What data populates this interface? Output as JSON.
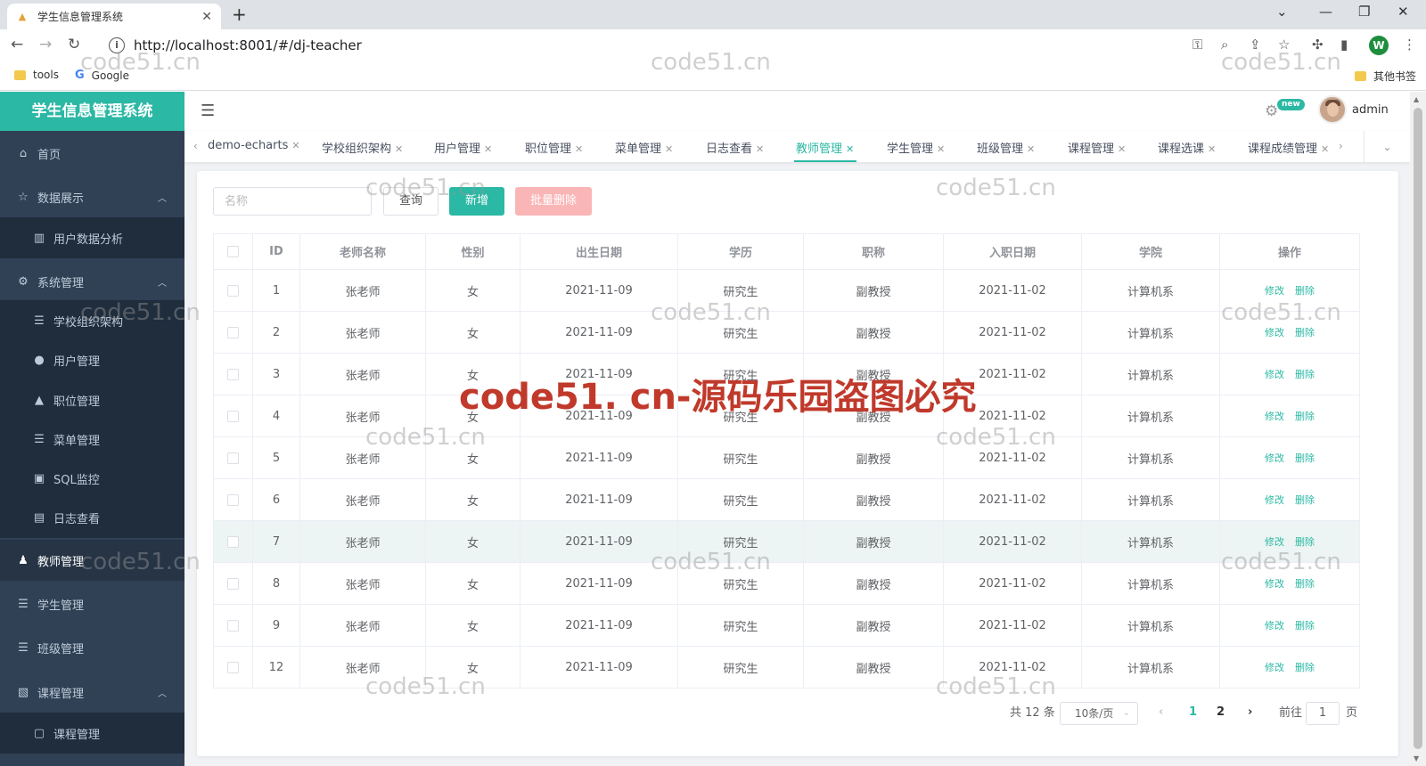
{
  "browser": {
    "tab_title": "学生信息管理系统",
    "tab_close": "✕",
    "new_tab": "+",
    "url": "http://localhost:8001/#/dj-teacher",
    "profile_initial": "W",
    "bookmarks": [
      "tools",
      "Google"
    ],
    "other_bookmarks": "其他书签"
  },
  "app": {
    "brand": "学生信息管理系统",
    "user": "admin",
    "new_badge": "new",
    "accent_color": "#2bb8a4"
  },
  "sidebar": {
    "items": [
      {
        "label": "首页",
        "icon": "home-icon",
        "level": "top"
      },
      {
        "label": "数据展示",
        "icon": "star-icon",
        "level": "top",
        "expanded": true
      },
      {
        "label": "用户数据分析",
        "icon": "bar-chart-icon",
        "level": "sub"
      },
      {
        "label": "系统管理",
        "icon": "gear-icon",
        "level": "top",
        "expanded": true
      },
      {
        "label": "学校组织架构",
        "icon": "list-icon",
        "level": "sub"
      },
      {
        "label": "用户管理",
        "icon": "user-icon",
        "level": "sub"
      },
      {
        "label": "职位管理",
        "icon": "lock-icon",
        "level": "sub"
      },
      {
        "label": "菜单管理",
        "icon": "list-icon",
        "level": "sub"
      },
      {
        "label": "SQL监控",
        "icon": "monitor-icon",
        "level": "sub"
      },
      {
        "label": "日志查看",
        "icon": "document-icon",
        "level": "sub"
      },
      {
        "label": "教师管理",
        "icon": "teacher-icon",
        "level": "top",
        "active": true
      },
      {
        "label": "学生管理",
        "icon": "list-icon",
        "level": "top"
      },
      {
        "label": "班级管理",
        "icon": "list-icon",
        "level": "top"
      },
      {
        "label": "课程管理",
        "icon": "book-icon",
        "level": "top",
        "expanded": true
      },
      {
        "label": "课程管理",
        "icon": "chat-icon",
        "level": "sub"
      }
    ]
  },
  "tags": [
    {
      "label": "demo-echarts"
    },
    {
      "label": "学校组织架构"
    },
    {
      "label": "用户管理"
    },
    {
      "label": "职位管理"
    },
    {
      "label": "菜单管理"
    },
    {
      "label": "日志查看"
    },
    {
      "label": "教师管理",
      "active": true
    },
    {
      "label": "学生管理"
    },
    {
      "label": "班级管理"
    },
    {
      "label": "课程管理"
    },
    {
      "label": "课程选课"
    },
    {
      "label": "课程成绩管理"
    }
  ],
  "toolbar": {
    "search_placeholder": "名称",
    "query": "查询",
    "add": "新增",
    "batch_delete": "批量删除"
  },
  "table": {
    "columns": [
      "ID",
      "老师名称",
      "性别",
      "出生日期",
      "学历",
      "职称",
      "入职日期",
      "学院",
      "操作"
    ],
    "edit_label": "修改",
    "delete_label": "删除",
    "rows": [
      {
        "id": "1",
        "name": "张老师",
        "gender": "女",
        "birth": "2021-11-09",
        "edu": "研究生",
        "title": "副教授",
        "hired": "2021-11-02",
        "college": "计算机系"
      },
      {
        "id": "2",
        "name": "张老师",
        "gender": "女",
        "birth": "2021-11-09",
        "edu": "研究生",
        "title": "副教授",
        "hired": "2021-11-02",
        "college": "计算机系"
      },
      {
        "id": "3",
        "name": "张老师",
        "gender": "女",
        "birth": "2021-11-09",
        "edu": "研究生",
        "title": "副教授",
        "hired": "2021-11-02",
        "college": "计算机系"
      },
      {
        "id": "4",
        "name": "张老师",
        "gender": "女",
        "birth": "2021-11-09",
        "edu": "研究生",
        "title": "副教授",
        "hired": "2021-11-02",
        "college": "计算机系"
      },
      {
        "id": "5",
        "name": "张老师",
        "gender": "女",
        "birth": "2021-11-09",
        "edu": "研究生",
        "title": "副教授",
        "hired": "2021-11-02",
        "college": "计算机系"
      },
      {
        "id": "6",
        "name": "张老师",
        "gender": "女",
        "birth": "2021-11-09",
        "edu": "研究生",
        "title": "副教授",
        "hired": "2021-11-02",
        "college": "计算机系"
      },
      {
        "id": "7",
        "name": "张老师",
        "gender": "女",
        "birth": "2021-11-09",
        "edu": "研究生",
        "title": "副教授",
        "hired": "2021-11-02",
        "college": "计算机系",
        "highlighted": true
      },
      {
        "id": "8",
        "name": "张老师",
        "gender": "女",
        "birth": "2021-11-09",
        "edu": "研究生",
        "title": "副教授",
        "hired": "2021-11-02",
        "college": "计算机系"
      },
      {
        "id": "9",
        "name": "张老师",
        "gender": "女",
        "birth": "2021-11-09",
        "edu": "研究生",
        "title": "副教授",
        "hired": "2021-11-02",
        "college": "计算机系"
      },
      {
        "id": "12",
        "name": "张老师",
        "gender": "女",
        "birth": "2021-11-09",
        "edu": "研究生",
        "title": "副教授",
        "hired": "2021-11-02",
        "college": "计算机系"
      }
    ]
  },
  "pagination": {
    "total_text": "共 12 条",
    "page_size": "10条/页",
    "pages": [
      "1",
      "2"
    ],
    "current_page": "1",
    "goto_label": "前往",
    "goto_value": "1",
    "page_suffix": "页"
  },
  "watermark": {
    "small": "code51.cn",
    "big": "code51. cn-源码乐园盗图必究"
  }
}
